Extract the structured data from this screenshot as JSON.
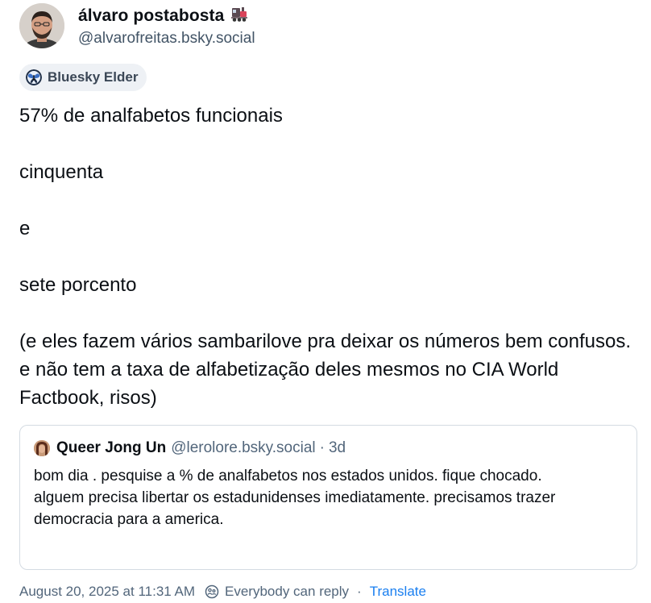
{
  "author": {
    "display_name": "álvaro postabosta",
    "name_emoji": "train-emoji",
    "handle": "@alvarofreitas.bsky.social"
  },
  "badge": {
    "label": "Bluesky Elder",
    "icon": "blue-moth-icon"
  },
  "post": {
    "paragraphs": [
      "57% de analfabetos funcionais",
      "cinquenta",
      "e",
      "sete porcento",
      "(e eles fazem vários sambarilove pra deixar os números bem confusos. e não tem a taxa de alfabetização deles mesmos no CIA World Factbook, risos)"
    ]
  },
  "quote": {
    "display_name": "Queer Jong Un",
    "handle": "@lerolore.bsky.social",
    "separator": "·",
    "time": "3d",
    "lines": [
      "bom dia . pesquise a % de analfabetos nos estados unidos. fique chocado.",
      "alguem precisa libertar os estadunidenses imediatamente. precisamos trazer democracia para a america."
    ]
  },
  "footer": {
    "timestamp": "August 20, 2025 at 11:31 AM",
    "reply_setting": "Everybody can reply",
    "separator": "·",
    "translate_label": "Translate"
  },
  "colors": {
    "text": "#0b0f14",
    "muted": "#52667b",
    "link": "#1a7ff0",
    "badge_bg": "#eef1f5",
    "border": "#d4dbe2"
  }
}
